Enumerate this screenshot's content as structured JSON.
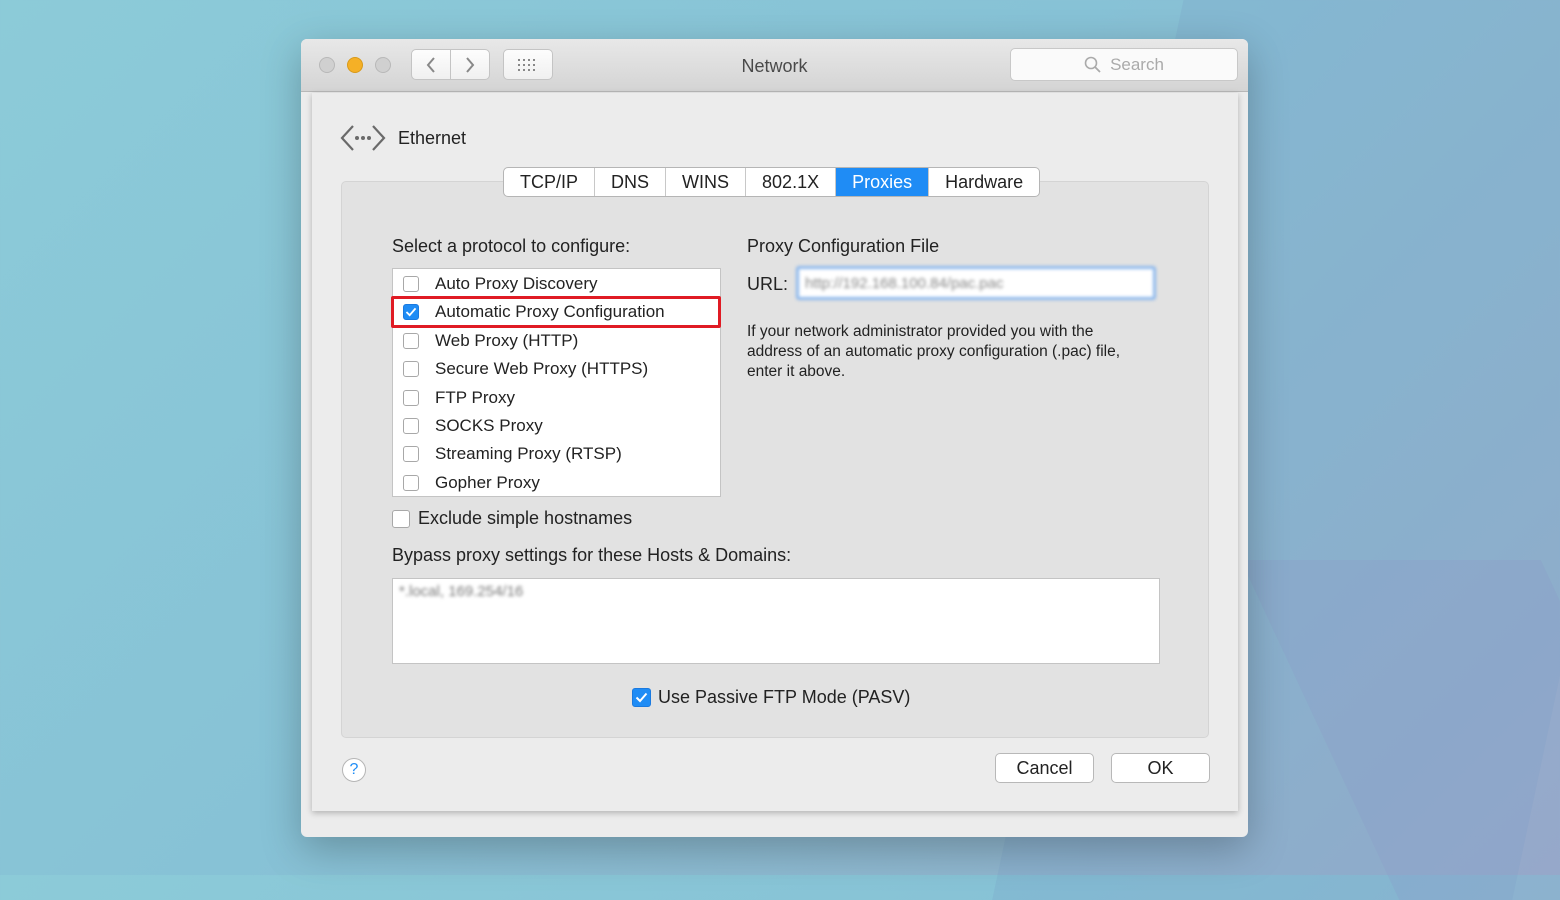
{
  "window": {
    "title": "Network",
    "search_placeholder": "Search"
  },
  "interface": {
    "name": "Ethernet",
    "icon": "ethernet-icon"
  },
  "tabs": [
    {
      "label": "TCP/IP",
      "active": false
    },
    {
      "label": "DNS",
      "active": false
    },
    {
      "label": "WINS",
      "active": false
    },
    {
      "label": "802.1X",
      "active": false
    },
    {
      "label": "Proxies",
      "active": true
    },
    {
      "label": "Hardware",
      "active": false
    }
  ],
  "protocols": {
    "label": "Select a protocol to configure:",
    "items": [
      {
        "label": "Auto Proxy Discovery",
        "checked": false
      },
      {
        "label": "Automatic Proxy Configuration",
        "checked": true,
        "highlighted": true
      },
      {
        "label": "Web Proxy (HTTP)",
        "checked": false
      },
      {
        "label": "Secure Web Proxy (HTTPS)",
        "checked": false
      },
      {
        "label": "FTP Proxy",
        "checked": false
      },
      {
        "label": "SOCKS Proxy",
        "checked": false
      },
      {
        "label": "Streaming Proxy (RTSP)",
        "checked": false
      },
      {
        "label": "Gopher Proxy",
        "checked": false
      }
    ]
  },
  "proxy_config": {
    "title": "Proxy Configuration File",
    "url_label": "URL:",
    "url_value": "http://192.168.100.84/pac.pac",
    "help_text": "If your network administrator provided you with the address of an automatic proxy configuration (.pac) file, enter it above."
  },
  "exclude_simple": {
    "label": "Exclude simple hostnames",
    "checked": false
  },
  "bypass": {
    "label": "Bypass proxy settings for these Hosts & Domains:",
    "value": "*.local, 169.254/16"
  },
  "passive_ftp": {
    "label": "Use Passive FTP Mode (PASV)",
    "checked": true
  },
  "buttons": {
    "help": "?",
    "cancel": "Cancel",
    "ok": "OK"
  },
  "colors": {
    "accent": "#1f8cf5",
    "highlight": "#e01b24"
  }
}
